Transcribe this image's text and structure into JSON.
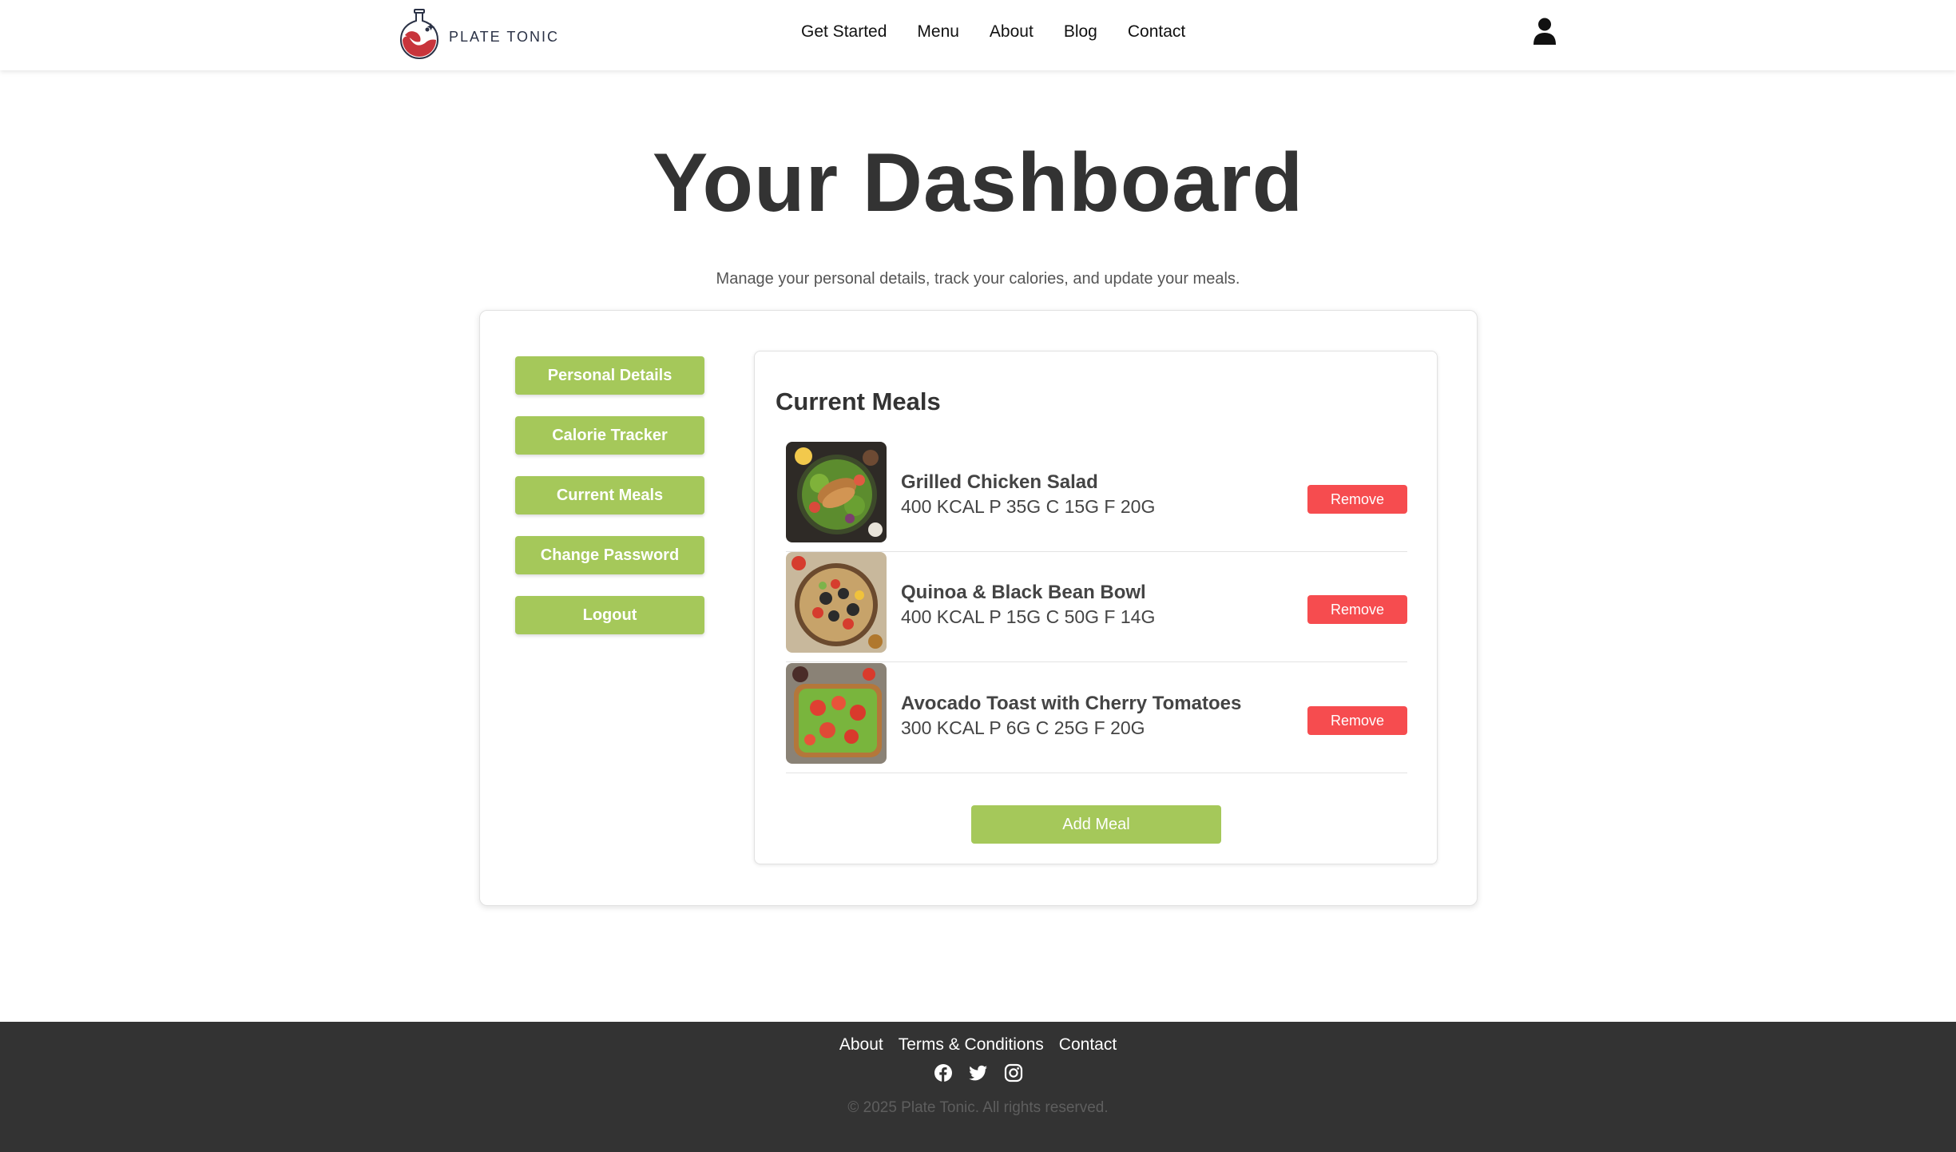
{
  "brand": {
    "name": "PLATE TONIC"
  },
  "nav": {
    "items": [
      "Get Started",
      "Menu",
      "About",
      "Blog",
      "Contact"
    ]
  },
  "page": {
    "title": "Your Dashboard",
    "subtitle": "Manage your personal details, track your calories, and update your meals."
  },
  "sidebar": {
    "items": [
      {
        "label": "Personal Details"
      },
      {
        "label": "Calorie Tracker"
      },
      {
        "label": "Current Meals"
      },
      {
        "label": "Change Password"
      },
      {
        "label": "Logout"
      }
    ]
  },
  "meals": {
    "title": "Current Meals",
    "items": [
      {
        "name": "Grilled Chicken Salad",
        "stats": "400 KCAL P 35G C 15G F 20G",
        "remove_label": "Remove",
        "image_icon": "salad-photo"
      },
      {
        "name": "Quinoa & Black Bean Bowl",
        "stats": "400 KCAL P 15G C 50G F 14G",
        "remove_label": "Remove",
        "image_icon": "bowl-photo"
      },
      {
        "name": "Avocado Toast with Cherry Tomatoes",
        "stats": "300 KCAL P 6G C 25G F 20G",
        "remove_label": "Remove",
        "image_icon": "toast-photo"
      }
    ],
    "add_label": "Add Meal"
  },
  "footer": {
    "links": [
      "About",
      "Terms & Conditions",
      "Contact"
    ],
    "social_icons": [
      "facebook-icon",
      "twitter-icon",
      "instagram-icon"
    ],
    "copyright": "© 2025 Plate Tonic. All rights reserved."
  },
  "colors": {
    "accent_green": "#a5c85a",
    "remove_red": "#f64c4f",
    "footer_bg": "#333333",
    "title_text": "#333333"
  }
}
